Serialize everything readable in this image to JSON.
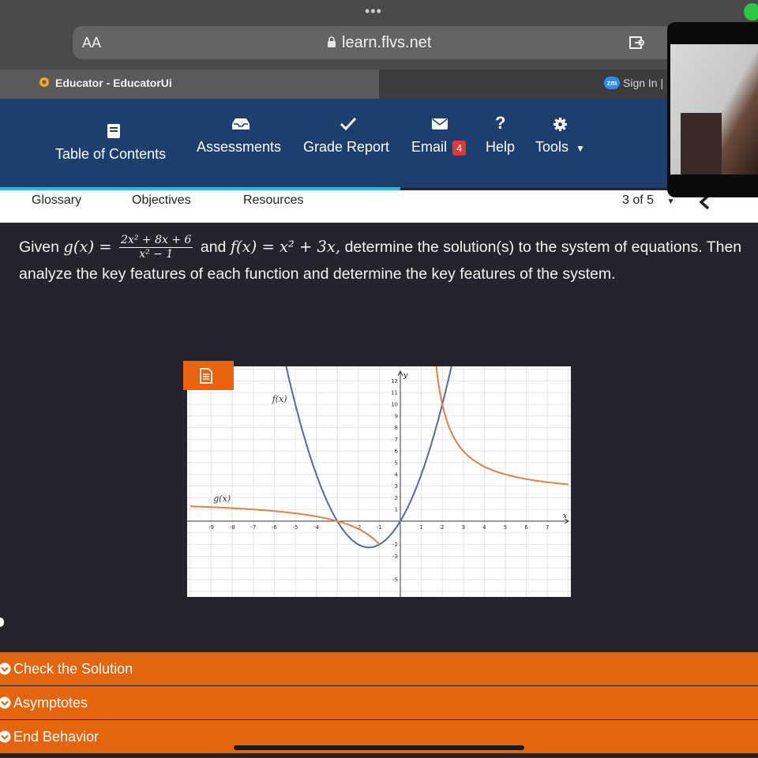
{
  "browser": {
    "aa_label": "AA",
    "url": "learn.flvs.net",
    "tab_title": "Educator - EducatorUi",
    "zoom_badge": "zm",
    "zoom_sign_in": "Sign In |"
  },
  "nav": {
    "items": [
      {
        "label": "Table of Contents",
        "icon": "book-icon"
      },
      {
        "label": "Assessments",
        "icon": "inbox-icon"
      },
      {
        "label": "Grade Report",
        "icon": "check-icon"
      },
      {
        "label": "Email",
        "icon": "envelope-icon",
        "badge": "4"
      },
      {
        "label": "Help",
        "icon": "question-icon"
      },
      {
        "label": "Tools",
        "icon": "gear-icon"
      }
    ]
  },
  "subnav": {
    "links": [
      "Glossary",
      "Objectives",
      "Resources"
    ],
    "page_indicator": "3 of 5"
  },
  "question": {
    "given": "Given",
    "g_lhs": "g(x) =",
    "g_num": "2x² + 8x + 6",
    "g_den": "x² − 1",
    "and": "and",
    "f_expr": "f(x) = x² + 3x,",
    "rest": "determine the solution(s) to the system of equations. Then analyze the key features of each function and determine the key features of the system."
  },
  "chart_data": {
    "type": "line",
    "xlabel": "x",
    "ylabel": "y",
    "xlim": [
      -10,
      8
    ],
    "ylim": [
      -6,
      13
    ],
    "grid": true,
    "x_ticks": [
      -9,
      -8,
      -7,
      -6,
      -5,
      -4,
      -2,
      -1,
      1,
      2,
      3,
      4,
      5,
      6,
      7
    ],
    "y_ticks": [
      12,
      11,
      10,
      9,
      8,
      7,
      6,
      5,
      4,
      3,
      2,
      1,
      -2,
      -3,
      -5
    ],
    "series": [
      {
        "name": "f(x)",
        "color": "#5c6a8a",
        "expr": "x^2 + 3x"
      },
      {
        "name": "g(x)",
        "color": "#d9824a",
        "expr": "(2x^2 + 8x + 6)/(x^2 - 1)"
      }
    ],
    "labels": {
      "f": "f(x)",
      "g": "g(x)"
    }
  },
  "accordions": [
    "Check the Solution",
    "Asymptotes",
    "End Behavior"
  ]
}
